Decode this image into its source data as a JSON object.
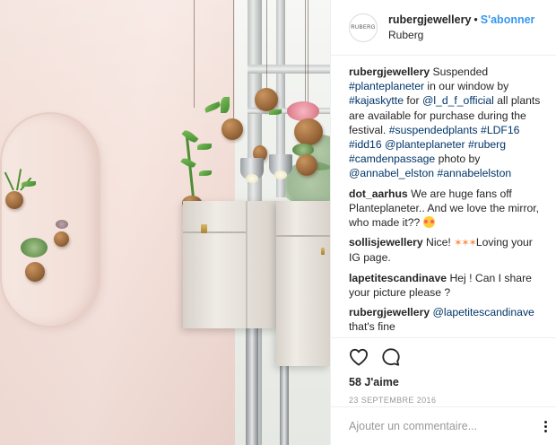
{
  "header": {
    "avatar_text": "RUBERG",
    "username": "rubergjewellery",
    "separator": "•",
    "follow_label": "S'abonner",
    "location": "Ruberg"
  },
  "caption": {
    "user": "rubergjewellery",
    "parts": [
      {
        "t": "Suspended "
      },
      {
        "t": "#planteplaneter",
        "link": true
      },
      {
        "t": " in our window by "
      },
      {
        "t": "#kajaskytte",
        "link": true
      },
      {
        "t": " for "
      },
      {
        "t": "@l_d_f_official",
        "link": true
      },
      {
        "t": " all plants are available for purchase during the festival. "
      },
      {
        "t": "#suspendedplants",
        "link": true
      },
      {
        "t": " "
      },
      {
        "t": "#LDF16",
        "link": true
      },
      {
        "t": " "
      },
      {
        "t": "#idd16",
        "link": true
      },
      {
        "t": " "
      },
      {
        "t": "@planteplaneter",
        "link": true
      },
      {
        "t": " "
      },
      {
        "t": "#ruberg",
        "link": true
      },
      {
        "t": " "
      },
      {
        "t": "#camdenpassage",
        "link": true
      },
      {
        "t": " photo by "
      },
      {
        "t": "@annabel_elston",
        "link": true
      },
      {
        "t": " "
      },
      {
        "t": "#annabelelston",
        "link": true
      }
    ]
  },
  "comments": [
    {
      "user": "dot_aarhus",
      "text": "We are huge fans off Planteplaneter.. And we love the mirror, who made it?? ",
      "emoji": "heart-eyes"
    },
    {
      "user": "sollisjewellery",
      "text_before": "Nice! ",
      "sparkles": "✶✶✶",
      "text": "Loving your IG page."
    },
    {
      "user": "lapetitescandinave",
      "text": "Hej ! Can I share your picture please ?"
    },
    {
      "user": "rubergjewellery",
      "mention": "@lapetitescandinave",
      "text": " that's fine"
    }
  ],
  "actions": {
    "like_icon": "heart-outline-icon",
    "comment_icon": "comment-bubble-icon",
    "likes": "58 J'aime",
    "date": "23 SEPTEMBRE 2016"
  },
  "add_comment": {
    "placeholder": "Ajouter un commentaire..."
  },
  "colors": {
    "link": "#003569",
    "follow": "#3897f0",
    "wall": "#f2ddd6"
  }
}
